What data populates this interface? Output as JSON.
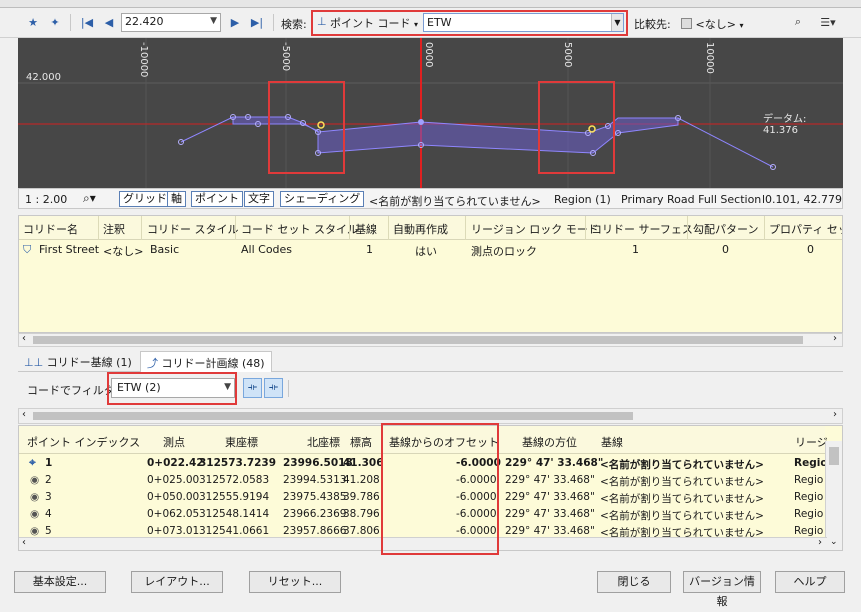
{
  "toolbar": {
    "station": "22.420",
    "search_label": "検索:",
    "search_type": "ポイント コード",
    "search_value": "ETW",
    "compare_label": "比較先:",
    "compare_value": "<なし>"
  },
  "viewport": {
    "axis_labels": [
      "-10000",
      "-5000",
      "0000",
      "5000",
      "10000"
    ],
    "elevation_label": "42.000",
    "datum_label": "データム: 41.376"
  },
  "viewport_status": {
    "scale": "1 : 2.00",
    "grid": "グリッド",
    "axis": "軸",
    "point": "ポイント",
    "text": "文字",
    "shading": "シェーディング",
    "unassigned": "<名前が割り当てられていません>",
    "region": "Region (1)",
    "assembly": "Primary Road Full Section",
    "coords": "l0.101, 42.779"
  },
  "corridor_table": {
    "headers": [
      "コリドー名",
      "注釈",
      "コリドー スタイル",
      "コード セット スタイル",
      "基線",
      "自動再作成",
      "リージョン ロック モード",
      "コリドー サーフェス",
      "勾配パターン",
      "プロパティ セット"
    ],
    "row": [
      "First Street",
      "<なし>",
      "Basic",
      "All Codes",
      "1",
      "はい",
      "測点のロック",
      "1",
      "0",
      "0"
    ]
  },
  "bottom_tabs": [
    "コリドー基線 (1)",
    "コリドー計画線 (48)"
  ],
  "filter": {
    "label": "コードでフィルタ:",
    "value": "ETW  (2)"
  },
  "points_table": {
    "headers": [
      "ポイント インデックス",
      "測点",
      "東座標",
      "北座標",
      "標高",
      "基線からのオフセット",
      "基線の方位",
      "基線",
      "リージ"
    ],
    "rows": [
      [
        "1",
        "0+022.42",
        "312573.7239",
        "23996.5018",
        "41.306",
        "-6.0000",
        "229° 47' 33.468\"",
        "<名前が割り当てられていません>",
        "Regio"
      ],
      [
        "2",
        "0+025.00",
        "312572.0583",
        "23994.5313",
        "41.208",
        "-6.0000",
        "229° 47' 33.468\"",
        "<名前が割り当てられていません>",
        "Regio"
      ],
      [
        "3",
        "0+050.00",
        "312555.9194",
        "23975.4385",
        "39.786",
        "-6.0000",
        "229° 47' 33.468\"",
        "<名前が割り当てられていません>",
        "Regio"
      ],
      [
        "4",
        "0+062.05",
        "312548.1414",
        "23966.2369",
        "38.796",
        "-6.0000",
        "229° 47' 33.468\"",
        "<名前が割り当てられていません>",
        "Regio"
      ],
      [
        "5",
        "0+073.01",
        "312541.0661",
        "23957.8666",
        "37.806",
        "-6.0000",
        "229° 47' 33.468\"",
        "<名前が割り当てられていません>",
        "Regio"
      ]
    ]
  },
  "buttons": {
    "settings": "基本設定...",
    "layout": "レイアウト...",
    "reset": "リセット...",
    "close": "閉じる",
    "version": "バージョン情報",
    "help": "ヘルプ"
  }
}
